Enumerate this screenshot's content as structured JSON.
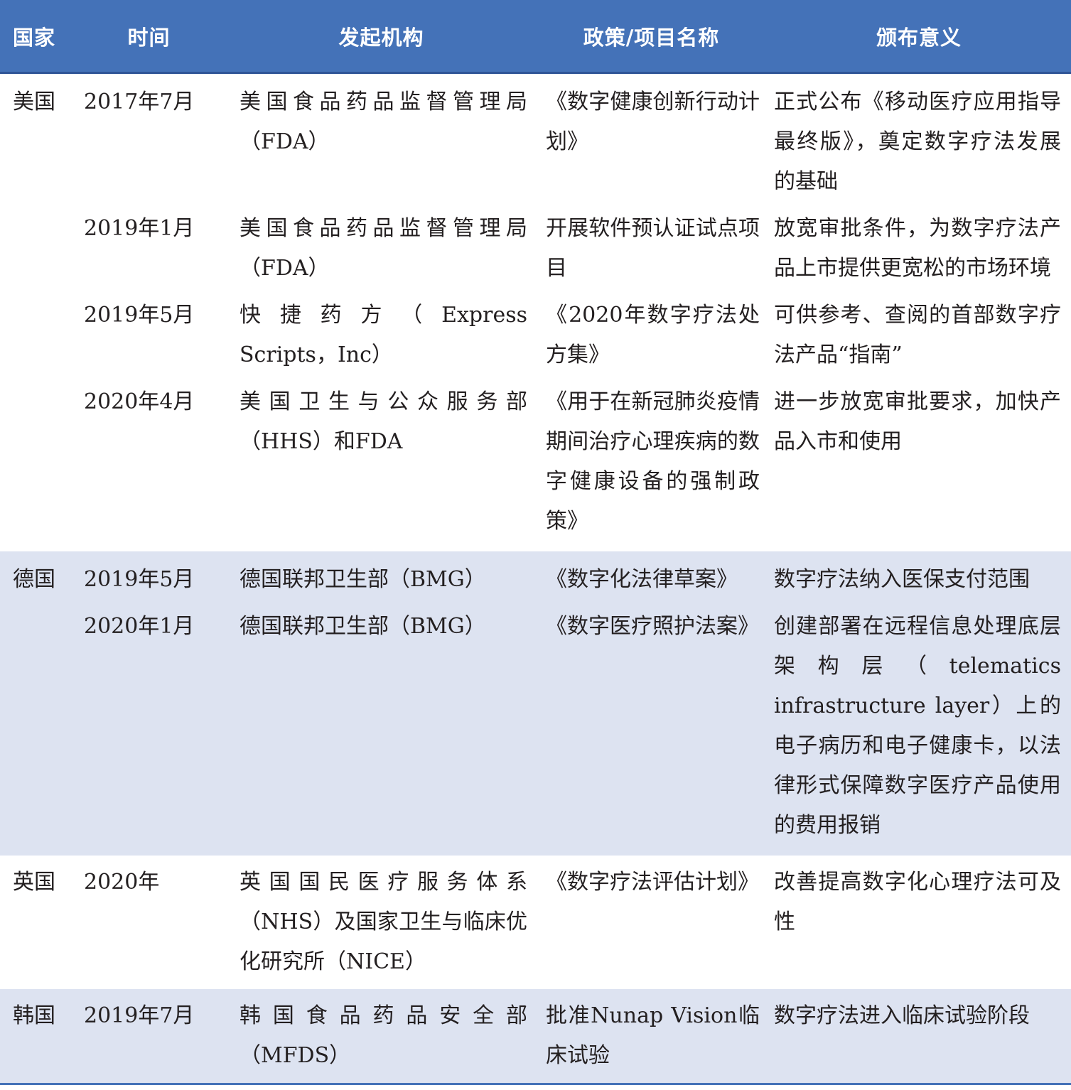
{
  "header": {
    "country": "国家",
    "date": "时间",
    "org": "发起机构",
    "policy": "政策/项目名称",
    "significance": "颁布意义"
  },
  "rows": [
    {
      "country": "美国",
      "date": "2017年7月",
      "org": "美国食品药品监督管理局（FDA）",
      "policy": "《数字健康创新行动计划》",
      "significance": "正式公布《移动医疗应用指导最终版》，奠定数字疗法发展的基础"
    },
    {
      "country": "",
      "date": "2019年1月",
      "org": "美国食品药品监督管理局（FDA）",
      "policy": "开展软件预认证试点项目",
      "significance": "放宽审批条件，为数字疗法产品上市提供更宽松的市场环境"
    },
    {
      "country": "",
      "date": "2019年5月",
      "org": "快捷药方（Express Scripts，Inc）",
      "policy": "《2020年数字疗法处方集》",
      "significance": "可供参考、查阅的首部数字疗法产品“指南”"
    },
    {
      "country": "",
      "date": "2020年4月",
      "org": "美国卫生与公众服务部（HHS）和FDA",
      "policy": "《用于在新冠肺炎疫情期间治疗心理疾病的数字健康设备的强制政策》",
      "significance": "进一步放宽审批要求，加快产品入市和使用"
    },
    {
      "country": "德国",
      "date": "2019年5月",
      "org": "德国联邦卫生部（BMG）",
      "policy": "《数字化法律草案》",
      "significance": "数字疗法纳入医保支付范围"
    },
    {
      "country": "",
      "date": "2020年1月",
      "org": "德国联邦卫生部（BMG）",
      "policy": "《数字医疗照护法案》",
      "significance": "创建部署在远程信息处理底层架构层（telematics infrastructure layer）上的电子病历和电子健康卡，以法律形式保障数字医疗产品使用的费用报销"
    },
    {
      "country": "英国",
      "date": "2020年",
      "org": "英国国民医疗服务体系（NHS）及国家卫生与临床优化研究所（NICE）",
      "policy": "《数字疗法评估计划》",
      "significance": "改善提高数字化心理疗法可及性"
    },
    {
      "country": "韩国",
      "date": "2019年7月",
      "org": "韩国食品药品安全部（MFDS）",
      "policy": "批准Nunap Vision临床试验",
      "significance": "数字疗法进入临床试验阶段"
    }
  ]
}
